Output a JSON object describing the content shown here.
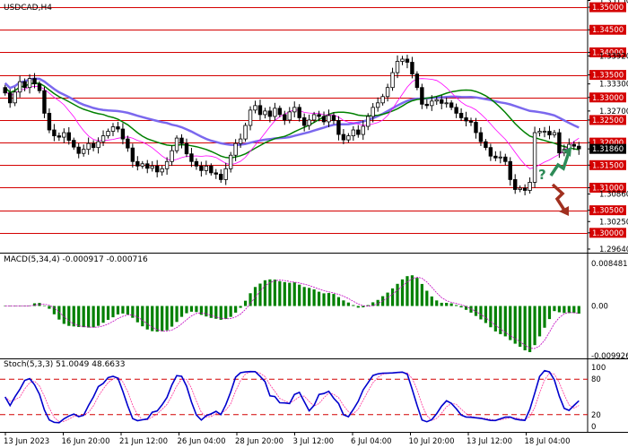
{
  "symbol_label": "USDCAD,H4",
  "colors": {
    "candle_up": "#000000",
    "candle_down": "#000000",
    "level_line": "#d40000",
    "label_bg": "#d40000",
    "ma_slow": "#7b68ee",
    "ma_mid": "#008000",
    "ma_fast": "#ff00ff",
    "macd_hist": "#008000",
    "macd_signal": "#c000c0",
    "stoch_main": "#0000cd",
    "stoch_signal": "#ff3399",
    "arrow_up": "#2e8b57",
    "arrow_down": "#a0301f",
    "question": "#2e8b57"
  },
  "price_axis": {
    "min": 1.2956,
    "max": 1.3516,
    "labels": [
      {
        "text": "1.35150",
        "value": 1.3515,
        "highlight": false
      },
      {
        "text": "1.35000",
        "value": 1.35,
        "highlight": true
      },
      {
        "text": "1.34500",
        "value": 1.345,
        "highlight": true
      },
      {
        "text": "1.34000",
        "value": 1.34,
        "highlight": true
      },
      {
        "text": "1.33920",
        "value": 1.3392,
        "highlight": false
      },
      {
        "text": "1.33500",
        "value": 1.335,
        "highlight": true
      },
      {
        "text": "1.33300",
        "value": 1.333,
        "highlight": false
      },
      {
        "text": "1.33000",
        "value": 1.33,
        "highlight": true
      },
      {
        "text": "1.32700",
        "value": 1.327,
        "highlight": false
      },
      {
        "text": "1.32500",
        "value": 1.325,
        "highlight": true
      },
      {
        "text": "1.32000",
        "value": 1.32,
        "highlight": true
      },
      {
        "text": "1.31860",
        "value": 1.3186,
        "highlight": false,
        "current": true
      },
      {
        "text": "1.31500",
        "value": 1.315,
        "highlight": true
      },
      {
        "text": "1.31000",
        "value": 1.31,
        "highlight": true
      },
      {
        "text": "1.30860",
        "value": 1.3086,
        "highlight": false
      },
      {
        "text": "1.30500",
        "value": 1.305,
        "highlight": true
      },
      {
        "text": "1.30250",
        "value": 1.3025,
        "highlight": false
      },
      {
        "text": "1.30000",
        "value": 1.3,
        "highlight": true
      },
      {
        "text": "1.29640",
        "value": 1.2964,
        "highlight": false
      }
    ],
    "levels": [
      1.35,
      1.345,
      1.34,
      1.335,
      1.33,
      1.325,
      1.32,
      1.315,
      1.31,
      1.305,
      1.3
    ]
  },
  "macd": {
    "label": "MACD(5,34,4) -0.000917 -0.000716",
    "min": -0.0101,
    "max": 0.00885,
    "labels": [
      {
        "text": "0.008481",
        "value": 0.008481
      },
      {
        "text": "0.00",
        "value": 0
      },
      {
        "text": "-0.009926",
        "value": -0.009926
      }
    ]
  },
  "stoch": {
    "label": "Stoch(5,3,3) 51.0049 48.6633",
    "labels": [
      {
        "text": "100",
        "value": 100
      },
      {
        "text": "80",
        "value": 80
      },
      {
        "text": "20",
        "value": 20
      },
      {
        "text": "0",
        "value": 0
      }
    ],
    "levels": [
      80,
      20
    ]
  },
  "time_axis": [
    "13 Jun 2023",
    "16 Jun 20:00",
    "21 Jun 12:00",
    "26 Jun 04:00",
    "28 Jun 20:00",
    "3 Jul 12:00",
    "6 Jul 04:00",
    "10 Jul 20:00",
    "13 Jul 12:00",
    "18 Jul 04:00"
  ],
  "forecast": {
    "question_mark": "?"
  },
  "chart_data": {
    "type": "candlestick",
    "closes": [
      1.331,
      1.3288,
      1.3312,
      1.3335,
      1.3322,
      1.3342,
      1.333,
      1.3315,
      1.3265,
      1.3228,
      1.3215,
      1.3212,
      1.3222,
      1.3205,
      1.319,
      1.3176,
      1.3185,
      1.3198,
      1.3189,
      1.3202,
      1.3215,
      1.3225,
      1.3235,
      1.323,
      1.3208,
      1.3188,
      1.3158,
      1.3148,
      1.3153,
      1.3143,
      1.3148,
      1.3135,
      1.3142,
      1.3158,
      1.3182,
      1.321,
      1.3198,
      1.3175,
      1.3158,
      1.3148,
      1.3138,
      1.3148,
      1.3133,
      1.313,
      1.3118,
      1.3142,
      1.3172,
      1.3198,
      1.3208,
      1.3238,
      1.3272,
      1.3282,
      1.3262,
      1.327,
      1.3258,
      1.3276,
      1.3262,
      1.325,
      1.3268,
      1.3278,
      1.3255,
      1.3238,
      1.325,
      1.3262,
      1.3258,
      1.3246,
      1.326,
      1.3249,
      1.3218,
      1.3206,
      1.3215,
      1.3228,
      1.3218,
      1.3236,
      1.3258,
      1.3278,
      1.3288,
      1.3302,
      1.3322,
      1.3355,
      1.338,
      1.3385,
      1.3378,
      1.3352,
      1.3322,
      1.3285,
      1.3282,
      1.3292,
      1.3295,
      1.3287,
      1.3288,
      1.3278,
      1.3265,
      1.3255,
      1.3248,
      1.3245,
      1.3222,
      1.3202,
      1.3189,
      1.317,
      1.3166,
      1.3168,
      1.3158,
      1.3118,
      1.3096,
      1.3099,
      1.3094,
      1.3112,
      1.3222,
      1.3225,
      1.3225,
      1.3217,
      1.3222,
      1.3177,
      1.3185,
      1.3196,
      1.3192,
      1.3186
    ],
    "forecast_arrows": [
      "up",
      "down"
    ]
  }
}
